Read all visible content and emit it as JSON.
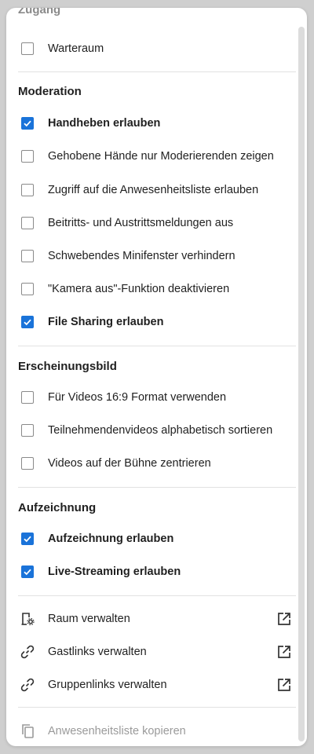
{
  "sections": {
    "zugang": {
      "title": "Zugang",
      "items": [
        {
          "label": "Warteraum",
          "checked": false
        }
      ]
    },
    "moderation": {
      "title": "Moderation",
      "items": [
        {
          "label": "Handheben erlauben",
          "checked": true
        },
        {
          "label": "Gehobene Hände nur Moderierenden zeigen",
          "checked": false
        },
        {
          "label": "Zugriff auf die Anwesenheitsliste erlauben",
          "checked": false
        },
        {
          "label": "Beitritts- und Austrittsmeldungen aus",
          "checked": false
        },
        {
          "label": "Schwebendes Minifenster verhindern",
          "checked": false
        },
        {
          "label": "\"Kamera aus\"-Funktion deaktivieren",
          "checked": false
        },
        {
          "label": "File Sharing erlauben",
          "checked": true
        }
      ]
    },
    "erscheinungsbild": {
      "title": "Erscheinungsbild",
      "items": [
        {
          "label": "Für Videos 16:9 Format verwenden",
          "checked": false
        },
        {
          "label": "Teilnehmendenvideos alphabetisch sortieren",
          "checked": false
        },
        {
          "label": "Videos auf der Bühne zentrieren",
          "checked": false
        }
      ]
    },
    "aufzeichnung": {
      "title": "Aufzeichnung",
      "items": [
        {
          "label": "Aufzeichnung erlauben",
          "checked": true
        },
        {
          "label": "Live-Streaming erlauben",
          "checked": true
        }
      ]
    }
  },
  "actions": [
    {
      "label": "Raum verwalten",
      "icon": "room-settings-icon"
    },
    {
      "label": "Gastlinks verwalten",
      "icon": "link-icon"
    },
    {
      "label": "Gruppenlinks verwalten",
      "icon": "link-icon"
    }
  ],
  "footer_action": {
    "label": "Anwesenheitsliste kopieren",
    "icon": "copy-icon",
    "disabled": true
  },
  "colors": {
    "accent": "#1a73d9",
    "text": "#1f1f1f",
    "muted": "#9a9a9a"
  }
}
